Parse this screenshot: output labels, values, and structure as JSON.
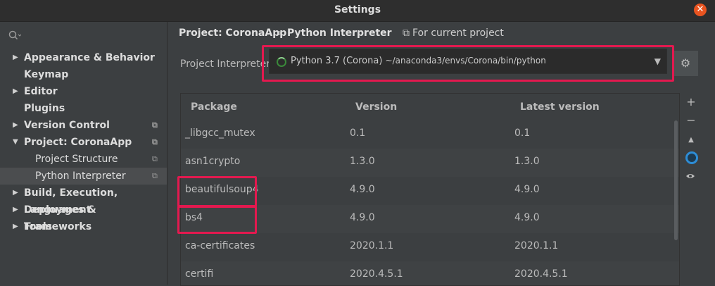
{
  "window": {
    "title": "Settings"
  },
  "sidebar": {
    "items": [
      {
        "label": "Appearance & Behavior",
        "expandable": true,
        "expanded": false,
        "copy": false
      },
      {
        "label": "Keymap",
        "expandable": false,
        "copy": false
      },
      {
        "label": "Editor",
        "expandable": true,
        "expanded": false,
        "copy": false
      },
      {
        "label": "Plugins",
        "expandable": false,
        "copy": false
      },
      {
        "label": "Version Control",
        "expandable": true,
        "expanded": false,
        "copy": true
      },
      {
        "label": "Project: CoronaApp",
        "expandable": true,
        "expanded": true,
        "copy": true
      },
      {
        "label": "Project Structure",
        "child": true,
        "copy": true
      },
      {
        "label": "Python Interpreter",
        "child": true,
        "copy": true,
        "selected": true
      },
      {
        "label": "Build, Execution, Deployment",
        "expandable": true,
        "expanded": false,
        "copy": false
      },
      {
        "label": "Languages & Frameworks",
        "expandable": true,
        "expanded": false,
        "copy": false
      },
      {
        "label": "Tools",
        "expandable": true,
        "expanded": false,
        "copy": false
      }
    ]
  },
  "breadcrumb": {
    "project": "Project: CoronaApp",
    "separator": "›",
    "page": "Python Interpreter",
    "note": "For current project"
  },
  "interpreter": {
    "label": "Project Interpreter:",
    "name": "Python 3.7 (Corona)",
    "path": "~/anaconda3/envs/Corona/bin/python"
  },
  "packages": {
    "columns": [
      "Package",
      "Version",
      "Latest version"
    ],
    "rows": [
      {
        "name": "_libgcc_mutex",
        "version": "0.1",
        "latest": "0.1"
      },
      {
        "name": "asn1crypto",
        "version": "1.3.0",
        "latest": "1.3.0"
      },
      {
        "name": "beautifulsoup4",
        "version": "4.9.0",
        "latest": "4.9.0"
      },
      {
        "name": "bs4",
        "version": "4.9.0",
        "latest": "4.9.0"
      },
      {
        "name": "ca-certificates",
        "version": "2020.1.1",
        "latest": "2020.1.1"
      },
      {
        "name": "certifi",
        "version": "2020.4.5.1",
        "latest": "2020.4.5.1"
      }
    ]
  },
  "toolbar": {
    "add": "+",
    "remove": "−",
    "upgrade": "▲"
  },
  "colors": {
    "highlight": "#e3194f",
    "conda": "#2d8dd6",
    "accent_close": "#e95420"
  }
}
